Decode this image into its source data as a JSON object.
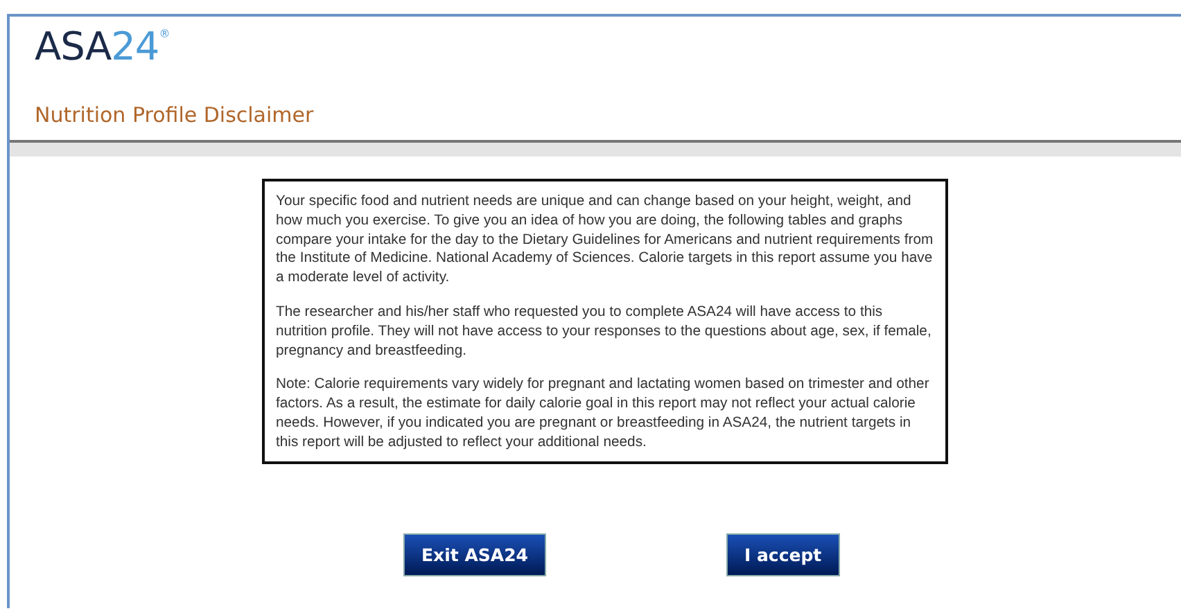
{
  "logo": {
    "main": "ASA",
    "number": "24",
    "mark": "®"
  },
  "page_title": "Nutrition Profile Disclaimer",
  "disclaimer": [
    "Your specific food and nutrient needs are unique and can change based on your height, weight, and how much you exercise. To give you an idea of how you are doing, the following tables and graphs compare your intake for the day to the Dietary Guidelines for Americans and nutrient requirements from the Institute of Medicine. National Academy of Sciences. Calorie targets in this report assume you have a moderate level of activity.",
    "The researcher and his/her staff who requested you to complete ASA24 will have access to this nutrition profile.  They will not have access to your responses to the questions about age, sex, if female, pregnancy and breastfeeding.",
    "Note: Calorie requirements vary widely for pregnant and lactating women based on trimester and other factors. As a result, the estimate for daily calorie goal in this report may not reflect your actual calorie needs. However, if you indicated you are pregnant or breastfeeding in ASA24, the nutrient targets in this report will be adjusted to reflect your additional needs."
  ],
  "buttons": [
    "Exit ASA24",
    "I accept"
  ]
}
